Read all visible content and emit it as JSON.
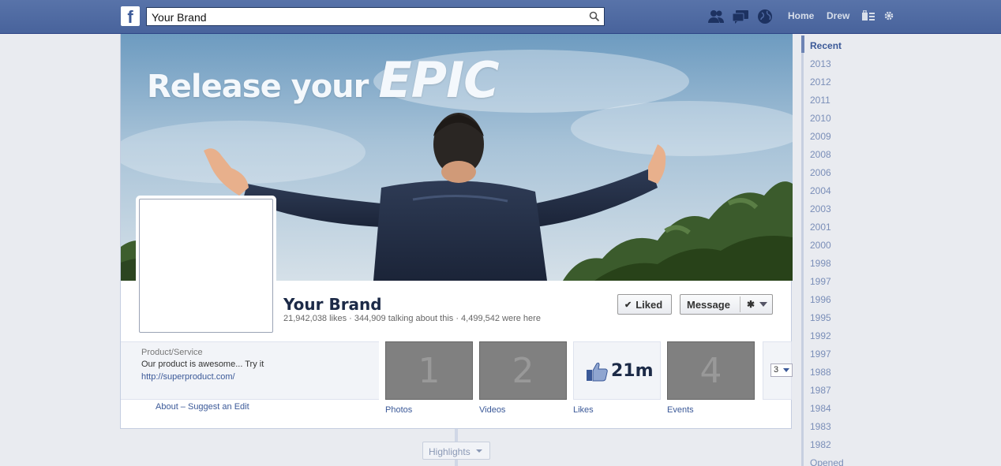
{
  "topbar": {
    "logo": "f",
    "search_value": "Your Brand",
    "nav_home": "Home",
    "nav_user": "Drew",
    "icons": [
      "friends-icon",
      "messages-icon",
      "notifications-icon",
      "privacy-icon",
      "settings-icon"
    ]
  },
  "cover": {
    "headline_small": "Release your ",
    "headline_big": "EPIC"
  },
  "page": {
    "name": "Your Brand",
    "stats": "21,942,038 likes · 344,909 talking about this · 4,499,542 were here"
  },
  "actions": {
    "liked_label": "Liked",
    "message_label": "Message"
  },
  "about": {
    "category": "Product/Service",
    "description": "Our product is awesome... Try it",
    "website": "http://superproduct.com/",
    "links": "About – Suggest an Edit"
  },
  "apps": [
    {
      "tile": "1",
      "label": "Photos"
    },
    {
      "tile": "2",
      "label": "Videos"
    },
    {
      "tile": "21m",
      "label": "Likes"
    },
    {
      "tile": "4",
      "label": "Events"
    }
  ],
  "more_count": "3",
  "timeline": {
    "highlights_label": "Highlights"
  },
  "yearnav": {
    "items": [
      "Recent",
      "2013",
      "2012",
      "2011",
      "2010",
      "2009",
      "2008",
      "2006",
      "2004",
      "2003",
      "2001",
      "2000",
      "1998",
      "1997",
      "1996",
      "1995",
      "1992",
      "1997",
      "1988",
      "1987",
      "1984",
      "1983",
      "1982",
      "Opened"
    ]
  },
  "colors": {
    "brand": "#3b5998",
    "topbar": "#4f6aa3",
    "link": "#3b5998",
    "year_link": "#7a8eb8"
  }
}
